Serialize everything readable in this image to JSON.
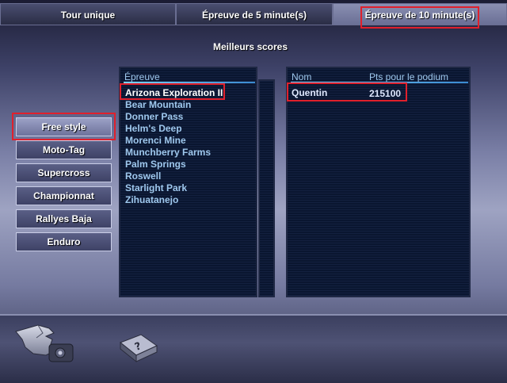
{
  "tabs": [
    {
      "label": "Tour unique"
    },
    {
      "label": "Épreuve de 5 minute(s)"
    },
    {
      "label": "Épreuve de 10 minute(s)"
    }
  ],
  "section_title": "Meilleurs scores",
  "tracks": {
    "header": "Épreuve",
    "items": [
      "Arizona Exploration II",
      "Bear Mountain",
      "Donner Pass",
      "Helm's Deep",
      "Morenci Mine",
      "Munchberry Farms",
      "Palm Springs",
      "Roswell",
      "Starlight Park",
      "Zihuatanejo"
    ]
  },
  "scores": {
    "header_name": "Nom",
    "header_points": "Pts pour le podium",
    "rows": [
      {
        "name": "Quentin",
        "points": "215100"
      }
    ]
  },
  "modes": [
    "Free style",
    "Moto-Tag",
    "Supercross",
    "Championnat",
    "Rallyes Baja",
    "Enduro"
  ],
  "icons": {
    "back": "pointing-hand-icon",
    "help": "help-book-icon"
  },
  "colors": {
    "highlight": "#e0202c",
    "list_text": "#9fc8ee",
    "panel_bg": "#0a1630"
  }
}
